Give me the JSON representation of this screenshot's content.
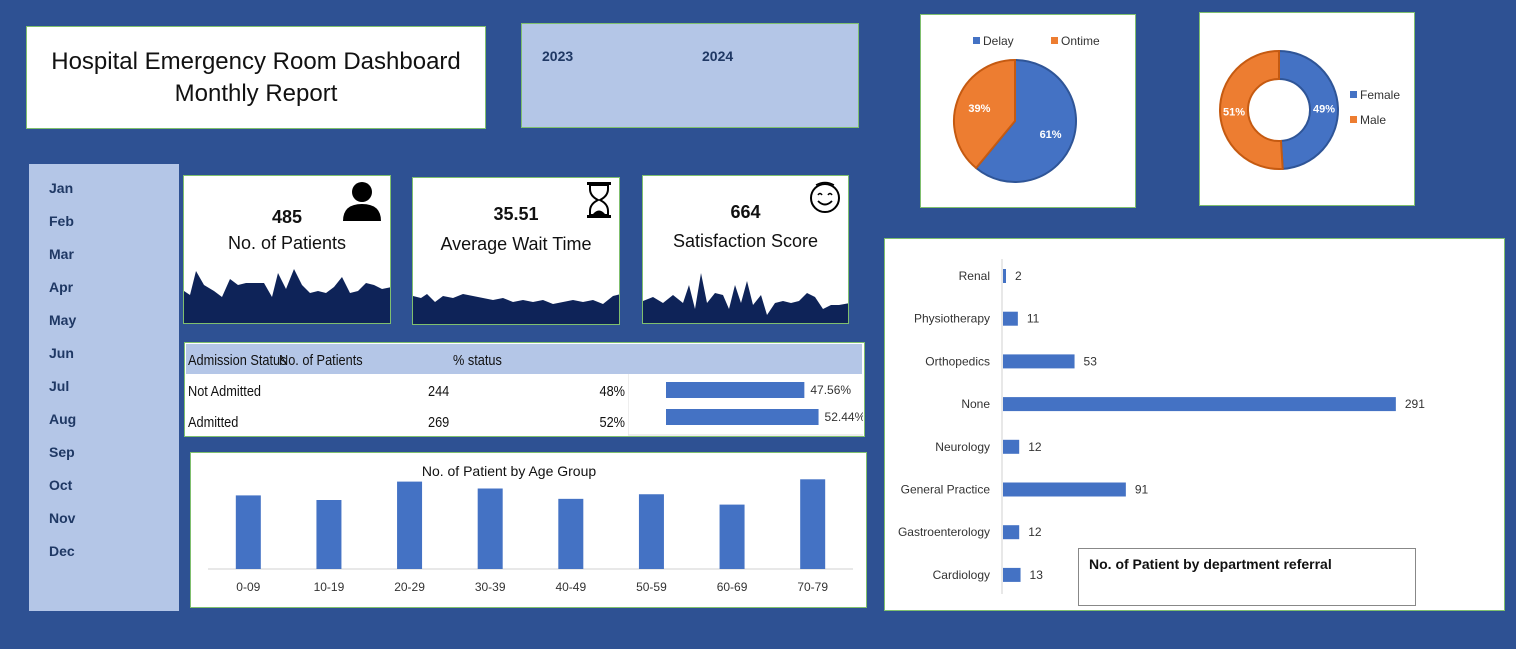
{
  "header": {
    "title_line1": "Hospital Emergency Room Dashboard",
    "title_line2": "Monthly Report"
  },
  "years": [
    "2023",
    "2024"
  ],
  "months": [
    "Jan",
    "Feb",
    "Mar",
    "Apr",
    "May",
    "Jun",
    "Jul",
    "Aug",
    "Sep",
    "Oct",
    "Nov",
    "Dec"
  ],
  "kpis": {
    "patients": {
      "value": "485",
      "label": "No. of Patients",
      "icon": "person-icon"
    },
    "wait": {
      "value": "35.51",
      "label": "Average Wait Time",
      "icon": "hourglass-icon"
    },
    "satisfaction": {
      "value": "664",
      "label": "Satisfaction Score",
      "icon": "smiley-icon"
    }
  },
  "admission": {
    "headers": [
      "Admission Status",
      "No. of Patients",
      "% status"
    ],
    "rows": [
      {
        "status": "Not Admitted",
        "count": "244",
        "pct": "48%",
        "bar_label": "47.56%",
        "bar_value": 47.56
      },
      {
        "status": "Admitted",
        "count": "269",
        "pct": "52%",
        "bar_label": "52.44%",
        "bar_value": 52.44
      }
    ]
  },
  "colors": {
    "blue": "#4472c4",
    "orange": "#ed7d31",
    "navy": "#0e2358",
    "panel": "#b4c6e7",
    "background": "#2e5193"
  },
  "chart_data": [
    {
      "type": "pie",
      "labels": [
        "Delay",
        "Ontime"
      ],
      "values": [
        61,
        39
      ],
      "value_labels": [
        "61%",
        "39%"
      ],
      "legend": "top"
    },
    {
      "type": "pie",
      "donut": true,
      "labels": [
        "Female",
        "Male"
      ],
      "values": [
        49,
        51
      ],
      "value_labels": [
        "49%",
        "51%"
      ],
      "legend": "right"
    },
    {
      "type": "bar",
      "title": "No. of Patient by Age Group",
      "categories": [
        "0-09",
        "10-19",
        "20-29",
        "30-39",
        "40-49",
        "50-59",
        "60-69",
        "70-79"
      ],
      "values": [
        64,
        60,
        76,
        70,
        61,
        65,
        56,
        78
      ],
      "ylim": [
        0,
        80
      ]
    },
    {
      "type": "bar",
      "orientation": "horizontal",
      "title": "No. of Patient by department referral",
      "categories": [
        "Renal",
        "Physiotherapy",
        "Orthopedics",
        "None",
        "Neurology",
        "General Practice",
        "Gastroenterology",
        "Cardiology"
      ],
      "values": [
        2,
        11,
        53,
        291,
        12,
        91,
        12,
        13
      ],
      "xlim": [
        0,
        300
      ]
    }
  ]
}
